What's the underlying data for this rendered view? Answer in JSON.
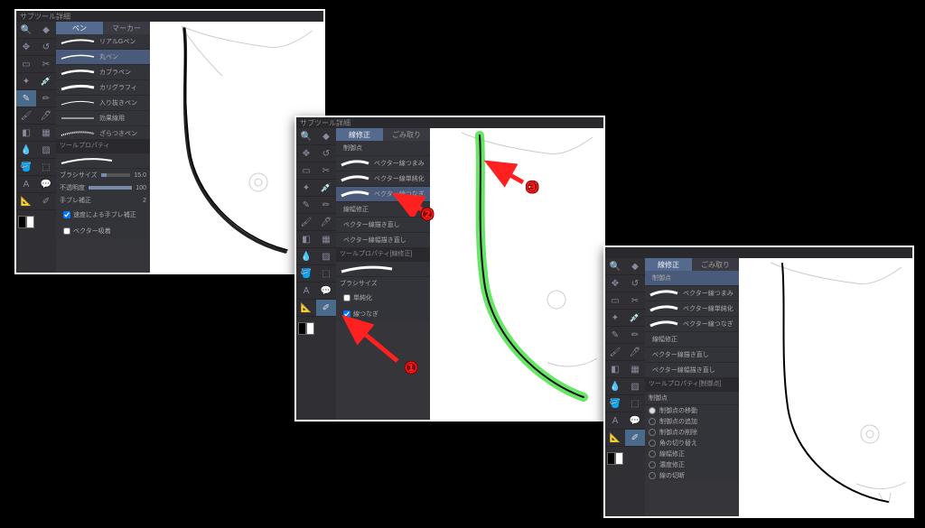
{
  "panel1": {
    "title": "サブツール詳細",
    "tabs": {
      "pen": "ペン",
      "marker": "マーカー"
    },
    "brushes": [
      "リアルGペン",
      "丸ペン",
      "カブラペン",
      "カリグラフィ",
      "入り抜きペン",
      "効果線用",
      "ざらつきペン"
    ],
    "prop_header": "ツールプロパティ",
    "brush_size_label": "ブラシサイズ",
    "brush_size_value": "15.0",
    "opacity_label": "不透明度",
    "opacity_value": "100",
    "anti_alias": "手ブレ補正",
    "anti_alias_value": "2",
    "stabilization": "速度による手ブレ補正",
    "vector_snap": "ベクター吸着"
  },
  "panel2": {
    "title": "サブツール詳細",
    "tabs": {
      "correct": "線修正",
      "cleanup": "ごみ取り"
    },
    "brushes": [
      "制御点",
      "ベクター線つまみ",
      "ベクター線単純化",
      "ベクター線つなぎ",
      "線幅修正",
      "ベクター線描き直し",
      "ベクター線幅描き直し"
    ],
    "prop_header": "ツールプロパティ[線修正]",
    "brush_size_label": "ブラシサイズ",
    "simplify": "単純化",
    "connect": "線つなぎ"
  },
  "panel3": {
    "title": "",
    "tabs": {
      "correct": "線修正",
      "cleanup": "ごみ取り"
    },
    "section1": "制御点",
    "brushes": [
      "ベクター線つまみ",
      "ベクター線単純化",
      "ベクター線つなぎ",
      "線幅修正",
      "ベクター線描き直し",
      "ベクター線幅描き直し"
    ],
    "prop_header": "ツールプロパティ[制御点]",
    "section2": "制御点",
    "radios": [
      "制御点の移動",
      "制御点の追加",
      "制御点の削除",
      "角の切り替え",
      "線幅修正",
      "濃度修正",
      "線の切断"
    ]
  },
  "callouts": {
    "one": "①",
    "two": "②",
    "three": "③"
  }
}
